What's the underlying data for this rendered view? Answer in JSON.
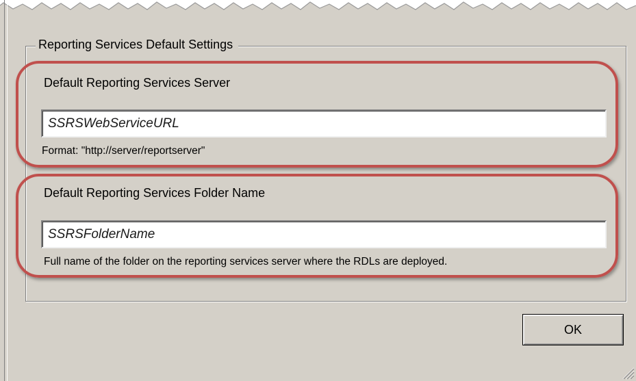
{
  "window": {
    "background": "#d4d0c8"
  },
  "groupbox": {
    "title": "Reporting Services Default Settings"
  },
  "server_field": {
    "label": "Default Reporting Services Server",
    "value": "SSRSWebServiceURL",
    "hint": "Format: \"http://server/reportserver\""
  },
  "folder_field": {
    "label": "Default Reporting Services Folder Name",
    "value": "SSRSFolderName",
    "hint": "Full name of the folder on the reporting services server where the RDLs are deployed."
  },
  "buttons": {
    "ok_label": "OK"
  },
  "annotation": {
    "highlight_color": "#c0504d"
  },
  "icons": {
    "size_grip": "size-grip-icon",
    "torn_edge": "torn-edge-decoration"
  }
}
